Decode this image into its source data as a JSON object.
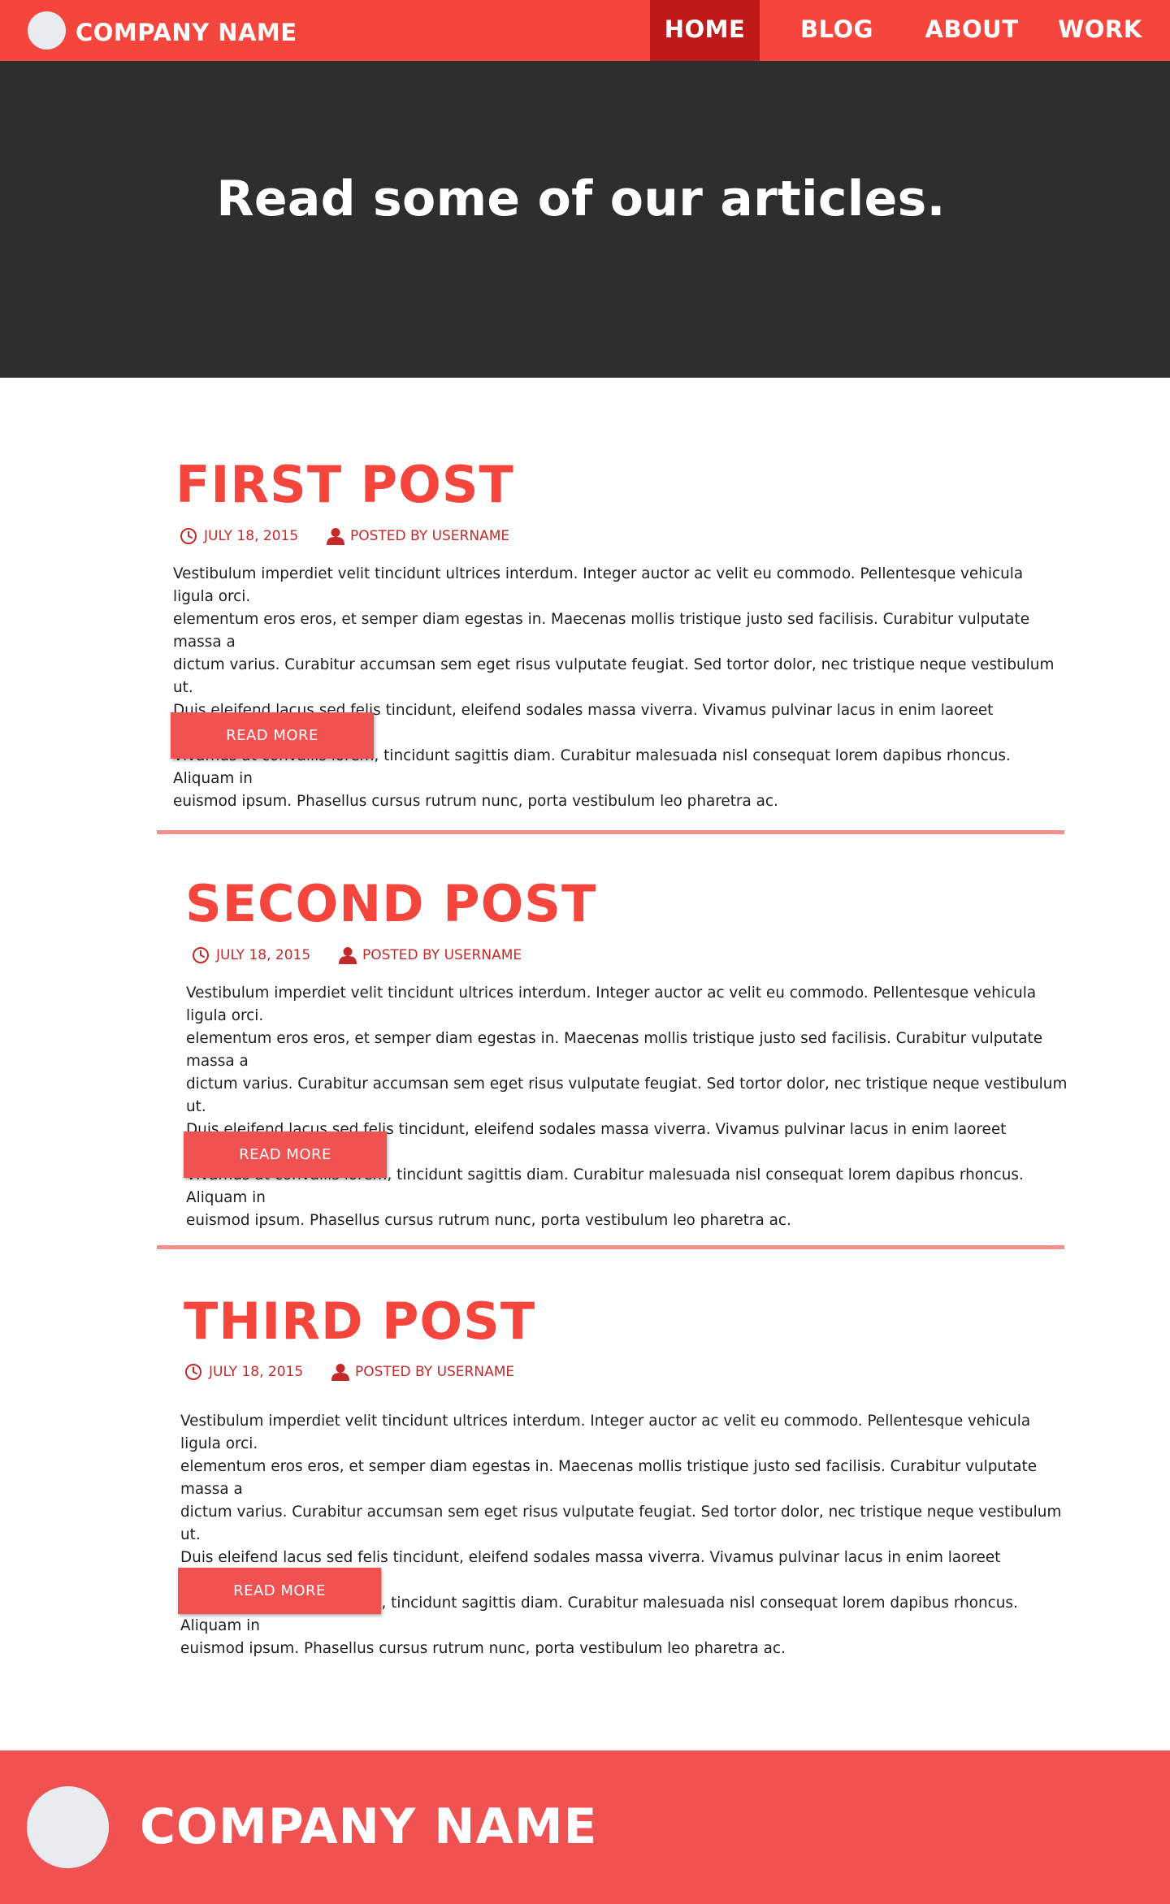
{
  "header": {
    "company_name": "COMPANY NAME",
    "nav": [
      {
        "label": "HOME",
        "active": true
      },
      {
        "label": "BLOG",
        "active": false
      },
      {
        "label": "ABOUT",
        "active": false
      },
      {
        "label": "WORK",
        "active": false
      }
    ]
  },
  "hero": {
    "title": "Read some of our articles."
  },
  "posts": [
    {
      "title": "FIRST POST",
      "date": "JULY 18, 2015",
      "author": "POSTED BY USERNAME",
      "body": "Vestibulum imperdiet velit tincidunt ultrices interdum. Integer auctor ac velit eu commodo. Pellentesque vehicula ligula orci.\nelementum eros eros, et semper diam egestas in. Maecenas mollis tristique justo sed facilisis. Curabitur vulputate massa a\ndictum varius. Curabitur accumsan sem eget risus vulputate feugiat. Sed  tortor dolor, nec tristique neque vestibulum ut.\nDuis eleifend lacus sed felis tincidunt, eleifend sodales massa viverra. Vivamus pulvinar lacus in enim laoreet scelerisque.\nVivamus at convallis lorem, tincidunt sagittis diam. Curabitur malesuada nisl consequat lorem dapibus rhoncus. Aliquam in\neuismod ipsum. Phasellus cursus rutrum nunc, porta vestibulum leo pharetra ac.",
      "button": "READ MORE"
    },
    {
      "title": "SECOND POST",
      "date": "JULY 18, 2015",
      "author": "POSTED BY USERNAME",
      "body": "Vestibulum imperdiet velit tincidunt ultrices interdum. Integer auctor ac velit eu commodo. Pellentesque vehicula ligula orci.\nelementum eros eros, et semper diam egestas in. Maecenas mollis tristique justo sed facilisis. Curabitur vulputate massa a\ndictum varius. Curabitur accumsan sem eget risus vulputate feugiat. Sed  tortor dolor, nec tristique neque vestibulum ut.\nDuis eleifend lacus sed felis tincidunt, eleifend sodales massa viverra. Vivamus pulvinar lacus in enim laoreet scelerisque.\nVivamus at convallis lorem, tincidunt sagittis diam. Curabitur malesuada nisl consequat lorem dapibus rhoncus. Aliquam in\neuismod ipsum. Phasellus cursus rutrum nunc, porta vestibulum leo pharetra ac.",
      "button": "READ MORE"
    },
    {
      "title": "THIRD POST",
      "date": "JULY 18, 2015",
      "author": "POSTED BY USERNAME",
      "body": "Vestibulum imperdiet velit tincidunt ultrices interdum. Integer auctor ac velit eu commodo. Pellentesque vehicula ligula orci.\nelementum eros eros, et semper diam egestas in. Maecenas mollis tristique justo sed facilisis. Curabitur vulputate massa a\ndictum varius. Curabitur accumsan sem eget risus vulputate feugiat. Sed  tortor dolor, nec tristique neque vestibulum ut.\nDuis eleifend lacus sed felis tincidunt, eleifend sodales massa viverra. Vivamus pulvinar lacus in enim laoreet scelerisque.\nVivamus at convallis lorem, tincidunt sagittis diam. Curabitur malesuada nisl consequat lorem dapibus rhoncus. Aliquam in\neuismod ipsum. Phasellus cursus rutrum nunc, porta vestibulum leo pharetra ac.",
      "button": "READ MORE"
    }
  ],
  "footer": {
    "company_name": "COMPANY NAME"
  },
  "icons": {
    "date": "clock-icon",
    "author": "user-icon"
  },
  "colors": {
    "brand_red": "#f4463c",
    "active_nav": "#bf1a1a",
    "hero_bg": "#2e2e2e",
    "button_bg": "#f05151",
    "divider": "#f38e88",
    "meta_text": "#c42a2a"
  }
}
